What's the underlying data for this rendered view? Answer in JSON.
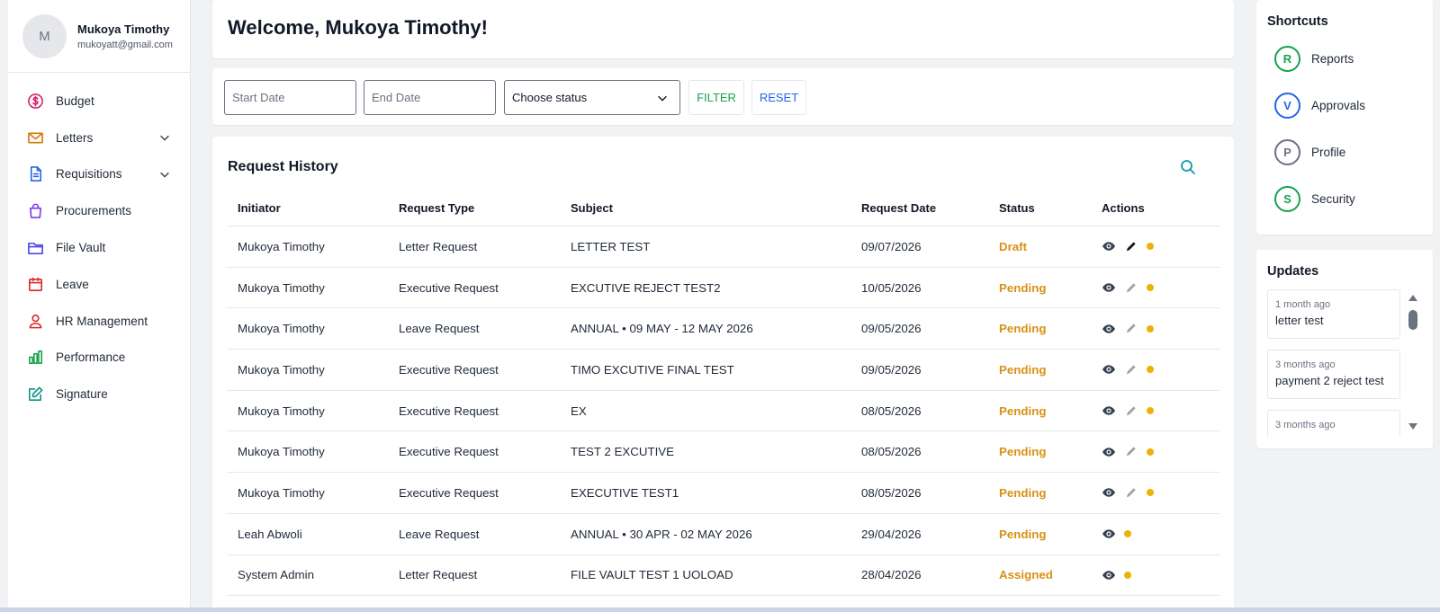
{
  "user": {
    "initial": "M",
    "name": "Mukoya Timothy",
    "email": "mukoyatt@gmail.com"
  },
  "sidebar": {
    "items": [
      {
        "label": "Budget",
        "icon": "dollar-icon",
        "color": "#d6246e"
      },
      {
        "label": "Letters",
        "icon": "mail-icon",
        "color": "#d97706",
        "expandable": true
      },
      {
        "label": "Requisitions",
        "icon": "document-icon",
        "color": "#2563eb",
        "expandable": true
      },
      {
        "label": "Procurements",
        "icon": "shopping-bag-icon",
        "color": "#7c3aed"
      },
      {
        "label": "File Vault",
        "icon": "folder-icon",
        "color": "#4f46e5"
      },
      {
        "label": "Leave",
        "icon": "calendar-icon",
        "color": "#dc2626"
      },
      {
        "label": "HR Management",
        "icon": "users-icon",
        "color": "#dc2626"
      },
      {
        "label": "Performance",
        "icon": "bar-chart-icon",
        "color": "#16a34a"
      },
      {
        "label": "Signature",
        "icon": "pen-square-icon",
        "color": "#0d9488"
      }
    ]
  },
  "welcome": {
    "title": "Welcome, Mukoya Timothy!"
  },
  "filters": {
    "start_placeholder": "Start Date",
    "end_placeholder": "End Date",
    "status_value": "Choose status",
    "filter_label": "FILTER",
    "reset_label": "RESET"
  },
  "history": {
    "title": "Request History",
    "columns": [
      "Initiator",
      "Request Type",
      "Subject",
      "Request Date",
      "Status",
      "Actions"
    ],
    "rows": [
      {
        "initiator": "Mukoya Timothy",
        "type": "Letter Request",
        "subject": "LETTER TEST",
        "date": "09/07/2026",
        "status": "Draft",
        "editable": true,
        "active": true
      },
      {
        "initiator": "Mukoya Timothy",
        "type": "Executive Request",
        "subject": "EXCUTIVE REJECT TEST2",
        "date": "10/05/2026",
        "status": "Pending",
        "editable": true
      },
      {
        "initiator": "Mukoya Timothy",
        "type": "Leave Request",
        "subject": "ANNUAL • 09 MAY - 12 MAY 2026",
        "date": "09/05/2026",
        "status": "Pending",
        "editable": true
      },
      {
        "initiator": "Mukoya Timothy",
        "type": "Executive Request",
        "subject": "TIMO EXCUTIVE FINAL TEST",
        "date": "09/05/2026",
        "status": "Pending",
        "editable": true
      },
      {
        "initiator": "Mukoya Timothy",
        "type": "Executive Request",
        "subject": "EX",
        "date": "08/05/2026",
        "status": "Pending",
        "editable": true
      },
      {
        "initiator": "Mukoya Timothy",
        "type": "Executive Request",
        "subject": "TEST 2 EXCUTIVE",
        "date": "08/05/2026",
        "status": "Pending",
        "editable": true
      },
      {
        "initiator": "Mukoya Timothy",
        "type": "Executive Request",
        "subject": "EXECUTIVE TEST1",
        "date": "08/05/2026",
        "status": "Pending",
        "editable": true
      },
      {
        "initiator": "Leah Abwoli",
        "type": "Leave Request",
        "subject": "ANNUAL • 30 APR - 02 MAY 2026",
        "date": "29/04/2026",
        "status": "Pending",
        "editable": false
      },
      {
        "initiator": "System Admin",
        "type": "Letter Request",
        "subject": "FILE VAULT TEST 1 UOLOAD",
        "date": "28/04/2026",
        "status": "Assigned",
        "editable": false
      }
    ]
  },
  "shortcuts": {
    "title": "Shortcuts",
    "items": [
      {
        "letter": "R",
        "label": "Reports",
        "color": "#16a34a"
      },
      {
        "letter": "V",
        "label": "Approvals",
        "color": "#2563eb"
      },
      {
        "letter": "P",
        "label": "Profile",
        "color": "#6b7280"
      },
      {
        "letter": "S",
        "label": "Security",
        "color": "#16a34a"
      }
    ]
  },
  "updates": {
    "title": "Updates",
    "items": [
      {
        "time": "1 month ago",
        "text": "letter test"
      },
      {
        "time": "3 months ago",
        "text": "payment 2 reject test"
      },
      {
        "time": "3 months ago",
        "text": ""
      }
    ]
  },
  "colors": {
    "status": "#d89114",
    "dot": "#eab308",
    "search": "#0e9aa7"
  }
}
